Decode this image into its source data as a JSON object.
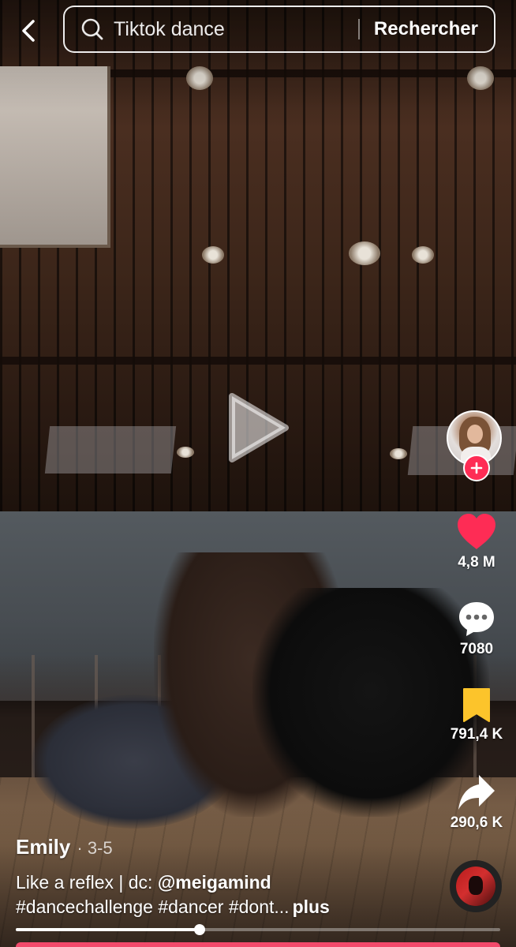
{
  "search": {
    "query": "Tiktok dance",
    "submit_label": "Rechercher"
  },
  "actions": {
    "likes": "4,8 M",
    "comments": "7080",
    "saves": "791,4 K",
    "shares": "290,6 K"
  },
  "post": {
    "author": "Emily",
    "date": " · 3-5",
    "caption_text": "Like a reflex | dc: ",
    "mention": "@meigamind",
    "hashtags": "#dancechallenge #dancer #dont...",
    "more_label": "plus"
  },
  "player": {
    "progress": 0.38
  },
  "colors": {
    "like": "#fe2c55",
    "save": "#fcc42b",
    "follow": "#fe2c55",
    "accent_bar": "#f24a6b"
  },
  "icons": {
    "back": "chevron-left-icon",
    "search": "search-icon",
    "play": "play-icon",
    "like": "heart-icon",
    "comment": "comment-bubble-icon",
    "save": "bookmark-icon",
    "share": "share-arrow-icon",
    "follow": "plus-icon"
  }
}
